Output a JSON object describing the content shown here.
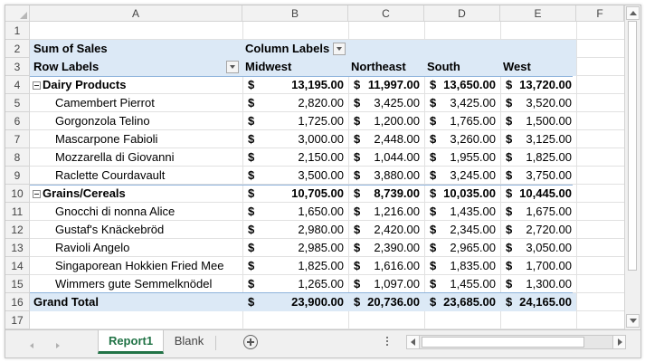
{
  "columns": [
    "A",
    "B",
    "C",
    "D",
    "E",
    "F"
  ],
  "rows": [
    "1",
    "2",
    "3",
    "4",
    "5",
    "6",
    "7",
    "8",
    "9",
    "10",
    "11",
    "12",
    "13",
    "14",
    "15",
    "16",
    "17"
  ],
  "pivot": {
    "sum_label": "Sum of Sales",
    "column_labels": "Column Labels",
    "row_labels": "Row Labels",
    "regions": [
      "Midwest",
      "Northeast",
      "South",
      "West"
    ],
    "currency_symbol": "$",
    "body": [
      {
        "label": "Dairy Products",
        "type": "group",
        "values": [
          "13,195.00",
          "11,997.00",
          "13,650.00",
          "13,720.00"
        ]
      },
      {
        "label": "Camembert Pierrot",
        "type": "item",
        "values": [
          "2,820.00",
          "3,425.00",
          "3,425.00",
          "3,520.00"
        ]
      },
      {
        "label": "Gorgonzola Telino",
        "type": "item",
        "values": [
          "1,725.00",
          "1,200.00",
          "1,765.00",
          "1,500.00"
        ]
      },
      {
        "label": "Mascarpone Fabioli",
        "type": "item",
        "values": [
          "3,000.00",
          "2,448.00",
          "3,260.00",
          "3,125.00"
        ]
      },
      {
        "label": "Mozzarella di Giovanni",
        "type": "item",
        "values": [
          "2,150.00",
          "1,044.00",
          "1,955.00",
          "1,825.00"
        ]
      },
      {
        "label": "Raclette Courdavault",
        "type": "item",
        "values": [
          "3,500.00",
          "3,880.00",
          "3,245.00",
          "3,750.00"
        ]
      },
      {
        "label": "Grains/Cereals",
        "type": "group",
        "values": [
          "10,705.00",
          "8,739.00",
          "10,035.00",
          "10,445.00"
        ]
      },
      {
        "label": "Gnocchi di nonna Alice",
        "type": "item",
        "values": [
          "1,650.00",
          "1,216.00",
          "1,435.00",
          "1,675.00"
        ]
      },
      {
        "label": "Gustaf's Knäckebröd",
        "type": "item",
        "values": [
          "2,980.00",
          "2,420.00",
          "2,345.00",
          "2,720.00"
        ]
      },
      {
        "label": "Ravioli Angelo",
        "type": "item",
        "values": [
          "2,985.00",
          "2,390.00",
          "2,965.00",
          "3,050.00"
        ]
      },
      {
        "label": "Singaporean Hokkien Fried Mee",
        "type": "item",
        "values": [
          "1,825.00",
          "1,616.00",
          "1,835.00",
          "1,700.00"
        ]
      },
      {
        "label": "Wimmers gute Semmelknödel",
        "type": "item",
        "values": [
          "1,265.00",
          "1,097.00",
          "1,455.00",
          "1,300.00"
        ]
      },
      {
        "label": "Grand Total",
        "type": "total",
        "values": [
          "23,900.00",
          "20,736.00",
          "23,685.00",
          "24,165.00"
        ]
      }
    ]
  },
  "sheets": [
    {
      "name": "Report1",
      "active": true
    },
    {
      "name": "Blank",
      "active": false
    }
  ],
  "colors": {
    "pivot_band": "#dce9f6",
    "active_tab": "#217346",
    "gridline": "#e1e1e1"
  },
  "icons": {
    "add_sheet": "plus-circle-icon",
    "collapse": "minus-box-icon",
    "filter": "dropdown-arrow-icon"
  }
}
